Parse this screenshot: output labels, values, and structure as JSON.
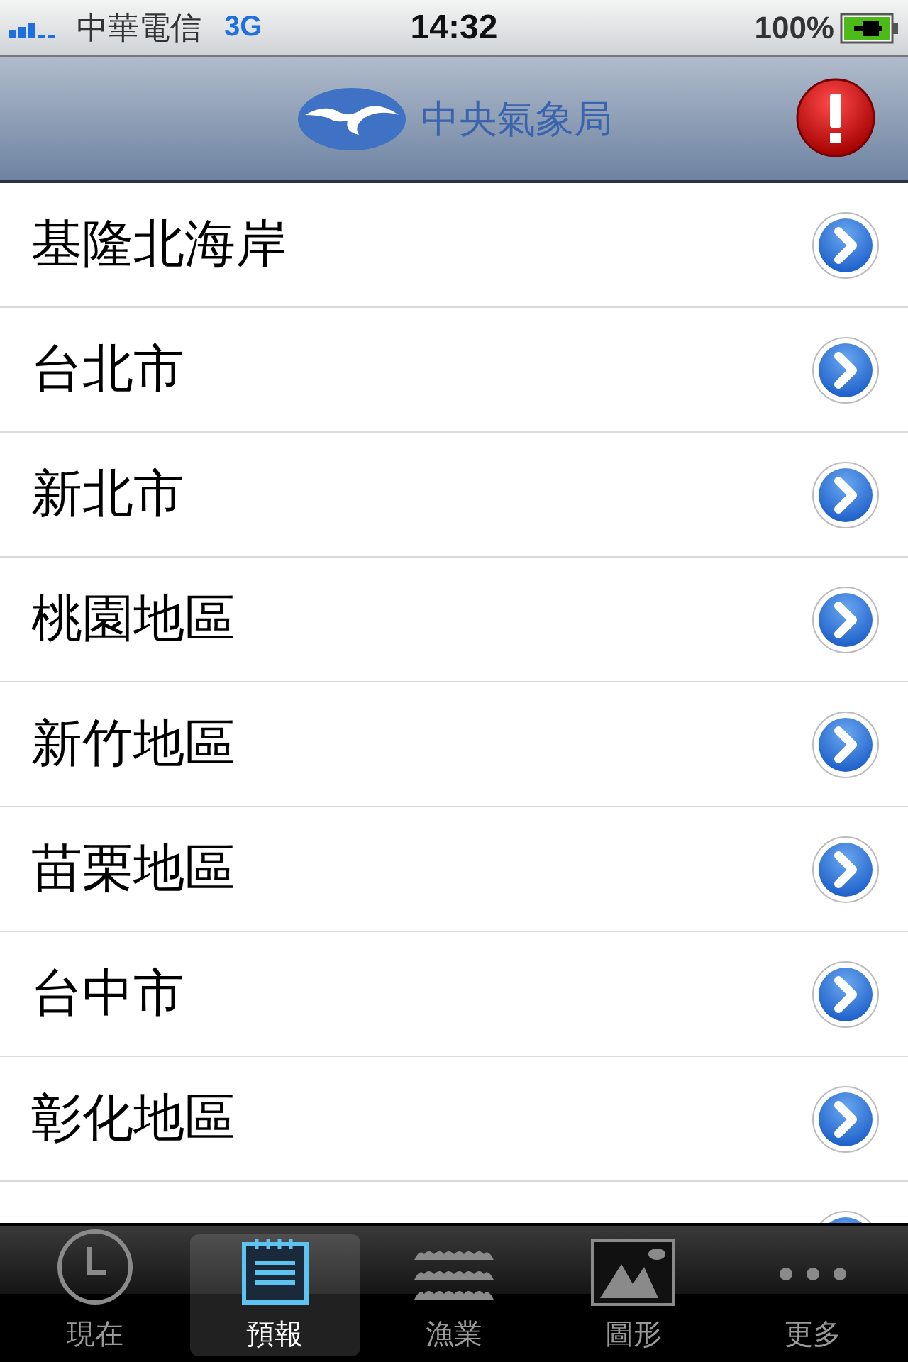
{
  "status_bar": {
    "carrier": "中華電信",
    "network": "3G",
    "time": "14:32",
    "battery": "100%"
  },
  "nav_bar": {
    "title": "中央氣象局"
  },
  "list": {
    "items": [
      {
        "label": "基隆北海岸"
      },
      {
        "label": "台北市"
      },
      {
        "label": "新北市"
      },
      {
        "label": "桃園地區"
      },
      {
        "label": "新竹地區"
      },
      {
        "label": "苗栗地區"
      },
      {
        "label": "台中市"
      },
      {
        "label": "彰化地區"
      }
    ]
  },
  "tab_bar": {
    "tabs": [
      {
        "label": "現在",
        "kind": "clock",
        "selected": false
      },
      {
        "label": "預報",
        "kind": "notepad",
        "selected": true
      },
      {
        "label": "漁業",
        "kind": "waves",
        "selected": false
      },
      {
        "label": "圖形",
        "kind": "image",
        "selected": false
      },
      {
        "label": "更多",
        "kind": "more",
        "selected": false
      }
    ]
  }
}
